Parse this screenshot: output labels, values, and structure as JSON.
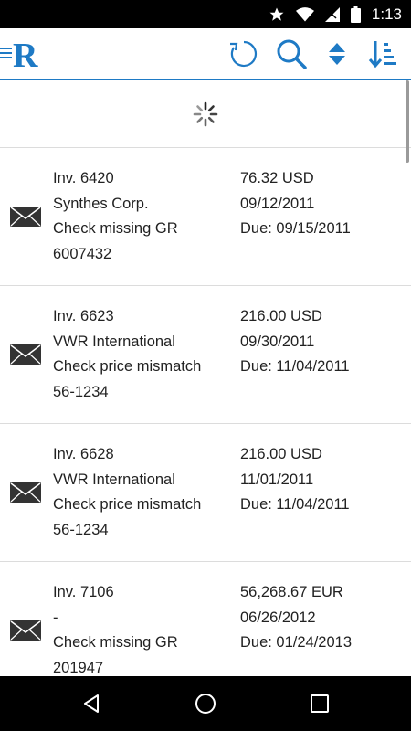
{
  "status_bar": {
    "time": "1:13",
    "icons": [
      "star-icon",
      "wifi-icon",
      "no-sim-icon",
      "battery-icon"
    ]
  },
  "app_bar": {
    "logo_letter": "R",
    "accent_color": "#1e7ac5",
    "actions": [
      "refresh-icon",
      "search-icon",
      "sort-toggle-icon",
      "sort-order-icon"
    ]
  },
  "invoices": [
    {
      "number": "Inv. 6420",
      "vendor": "Synthes Corp.",
      "issue": "Check missing GR",
      "reference": "6007432",
      "amount": "76.32 USD",
      "date": "09/12/2011",
      "due": "Due: 09/15/2011"
    },
    {
      "number": "Inv. 6623",
      "vendor": "VWR International",
      "issue": "Check price mismatch",
      "reference": "56-1234",
      "amount": "216.00 USD",
      "date": "09/30/2011",
      "due": "Due: 11/04/2011"
    },
    {
      "number": "Inv. 6628",
      "vendor": "VWR International",
      "issue": "Check price mismatch",
      "reference": "56-1234",
      "amount": "216.00 USD",
      "date": "11/01/2011",
      "due": "Due: 11/04/2011"
    },
    {
      "number": "Inv. 7106",
      "vendor": "-",
      "issue": "Check missing GR",
      "reference": "201947",
      "amount": "56,268.67 EUR",
      "date": "06/26/2012",
      "due": "Due: 01/24/2013"
    }
  ],
  "nav_bar": {
    "buttons": [
      "back-icon",
      "home-icon",
      "recents-icon"
    ]
  }
}
